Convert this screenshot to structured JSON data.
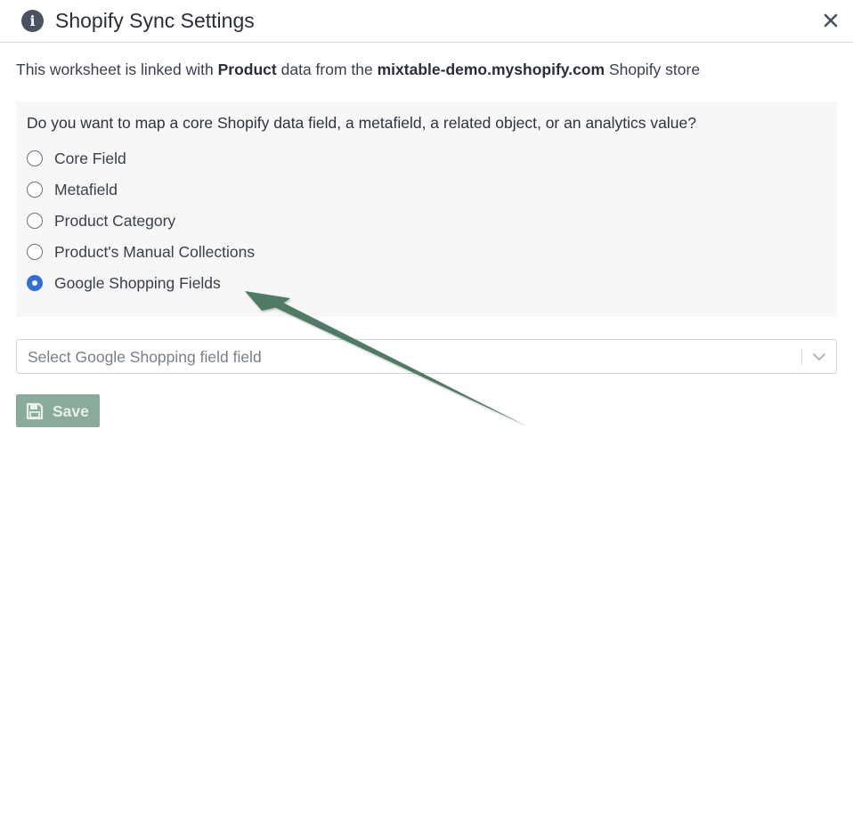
{
  "dialog": {
    "title": "Shopify Sync Settings",
    "close_label": "×"
  },
  "intro": {
    "prefix": "This worksheet is linked with",
    "object": "Product",
    "middle": "data from the",
    "store": "mixtable-demo.myshopify.com",
    "suffix": "Shopify store"
  },
  "panel": {
    "question": "Do you want to map a core Shopify data field, a metafield, a related object, or an analytics value?",
    "options": [
      {
        "label": "Core Field",
        "checked": false
      },
      {
        "label": "Metafield",
        "checked": false
      },
      {
        "label": "Product Category",
        "checked": false
      },
      {
        "label": "Product's Manual Collections",
        "checked": false
      },
      {
        "label": "Google Shopping Fields",
        "checked": true
      }
    ]
  },
  "field_select": {
    "placeholder": "Select Google Shopping field field"
  },
  "save_button": {
    "label": "Save",
    "enabled": false
  },
  "icons": {
    "info": "info-icon",
    "close": "close-icon",
    "chevron": "chevron-down-icon",
    "save": "floppy-disk-icon",
    "annotation": "arrow-annotation"
  },
  "colors": {
    "radio_checked": "#2f6fd6",
    "save_button_bg": "#8aab9c",
    "arrow": "#4f7a64",
    "panel_bg": "#f7f7f7"
  }
}
